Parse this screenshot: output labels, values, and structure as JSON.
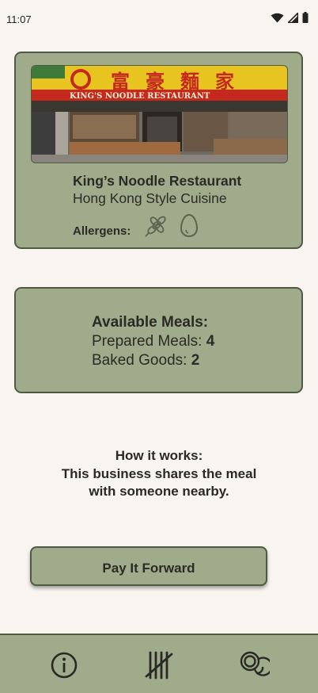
{
  "status": {
    "time": "11:07",
    "icons": [
      "wifi-icon",
      "signal-icon",
      "battery-icon"
    ]
  },
  "restaurant": {
    "photo_sign_cn": "富豪麵家",
    "photo_sign_en": "KING'S NOODLE RESTAURANT",
    "name": "King’s Noodle Restaurant",
    "cuisine": "Hong Kong Style Cuisine",
    "allergens_label": "Allergens:",
    "allergens": [
      "wheat-icon",
      "egg-icon"
    ]
  },
  "meals": {
    "title": "Available Meals:",
    "prepared_label": "Prepared Meals: ",
    "prepared_count": "4",
    "baked_label": "Baked Goods: ",
    "baked_count": "2"
  },
  "how": {
    "title": "How it works:",
    "text": "This business shares the meal with someone nearby."
  },
  "actions": {
    "pay_forward": "Pay It Forward"
  },
  "nav": {
    "items": [
      "info-icon",
      "tally-icon",
      "coins-icon"
    ]
  },
  "colors": {
    "background": "#f8f5f0",
    "card": "#a0ab8c",
    "border": "#4f5a43",
    "text": "#2b2b26"
  }
}
